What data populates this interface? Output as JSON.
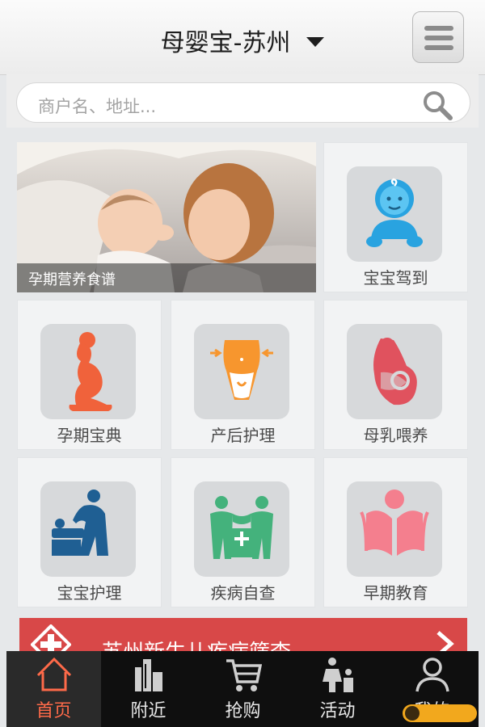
{
  "header": {
    "title": "母婴宝-苏州"
  },
  "search": {
    "placeholder": "商户名、地址..."
  },
  "banner": {
    "caption": "孕期营养食谱"
  },
  "tiles": [
    {
      "label": "宝宝驾到",
      "icon": "baby-face-icon"
    },
    {
      "label": "孕期宝典",
      "icon": "pregnant-woman-icon"
    },
    {
      "label": "产后护理",
      "icon": "postpartum-waist-icon"
    },
    {
      "label": "母乳喂养",
      "icon": "breastfeeding-icon"
    },
    {
      "label": "宝宝护理",
      "icon": "baby-care-icon"
    },
    {
      "label": "疾病自查",
      "icon": "family-health-icon"
    },
    {
      "label": "早期教育",
      "icon": "early-education-icon"
    }
  ],
  "promo": {
    "text": "苏州新生儿疾病筛查"
  },
  "tabs": [
    {
      "label": "首页",
      "icon": "home-icon",
      "active": true
    },
    {
      "label": "附近",
      "icon": "nearby-buildings-icon"
    },
    {
      "label": "抢购",
      "icon": "cart-icon"
    },
    {
      "label": "活动",
      "icon": "family-icon"
    },
    {
      "label": "我的",
      "icon": "user-icon"
    }
  ],
  "colors": {
    "accent": "#ff6a49",
    "promo": "#d84848",
    "tabbar": "#0f0f0f"
  }
}
